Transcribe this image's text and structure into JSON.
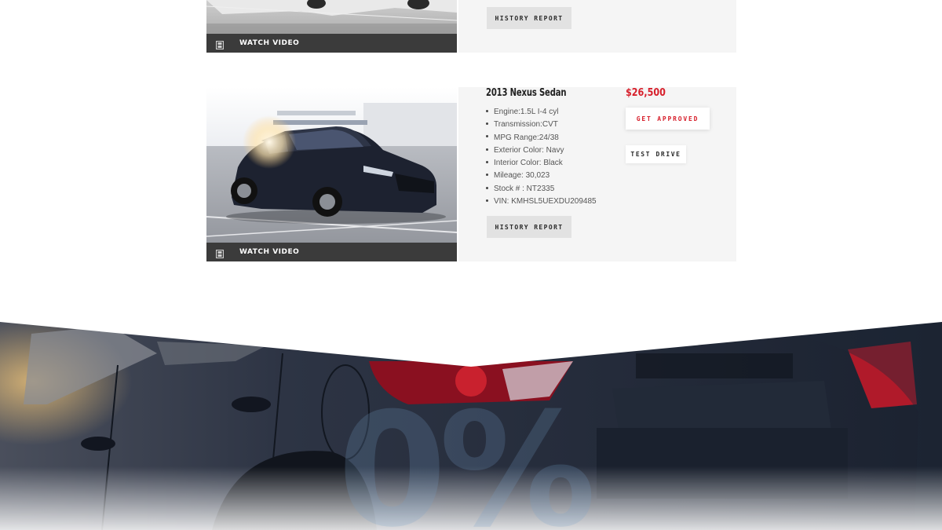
{
  "listings": [
    {
      "history_label": "HISTORY REPORT",
      "watch_label": "WATCH VIDEO"
    },
    {
      "title": "2013 Nexus Sedan",
      "price": "$26,500",
      "specs": [
        "Engine:1.5L I-4 cyl",
        "Transmission:CVT",
        "MPG Range:24/38",
        "Exterior Color: Navy",
        "Interior Color: Black",
        "Mileage: 30,023",
        "Stock # : NT2335",
        "VIN: KMHSL5UEXDU209485"
      ],
      "approve_label": "GET APPROVED",
      "drive_label": "TEST DRIVE",
      "history_label": "HISTORY REPORT",
      "watch_label": "WATCH VIDEO"
    }
  ],
  "hero": {
    "big_text": "0%"
  },
  "colors": {
    "accent": "#d71f2b",
    "info_bg": "#f5f5f5",
    "watch_bar": "#3b3b3b"
  },
  "icons": {
    "watch": "film-icon"
  }
}
